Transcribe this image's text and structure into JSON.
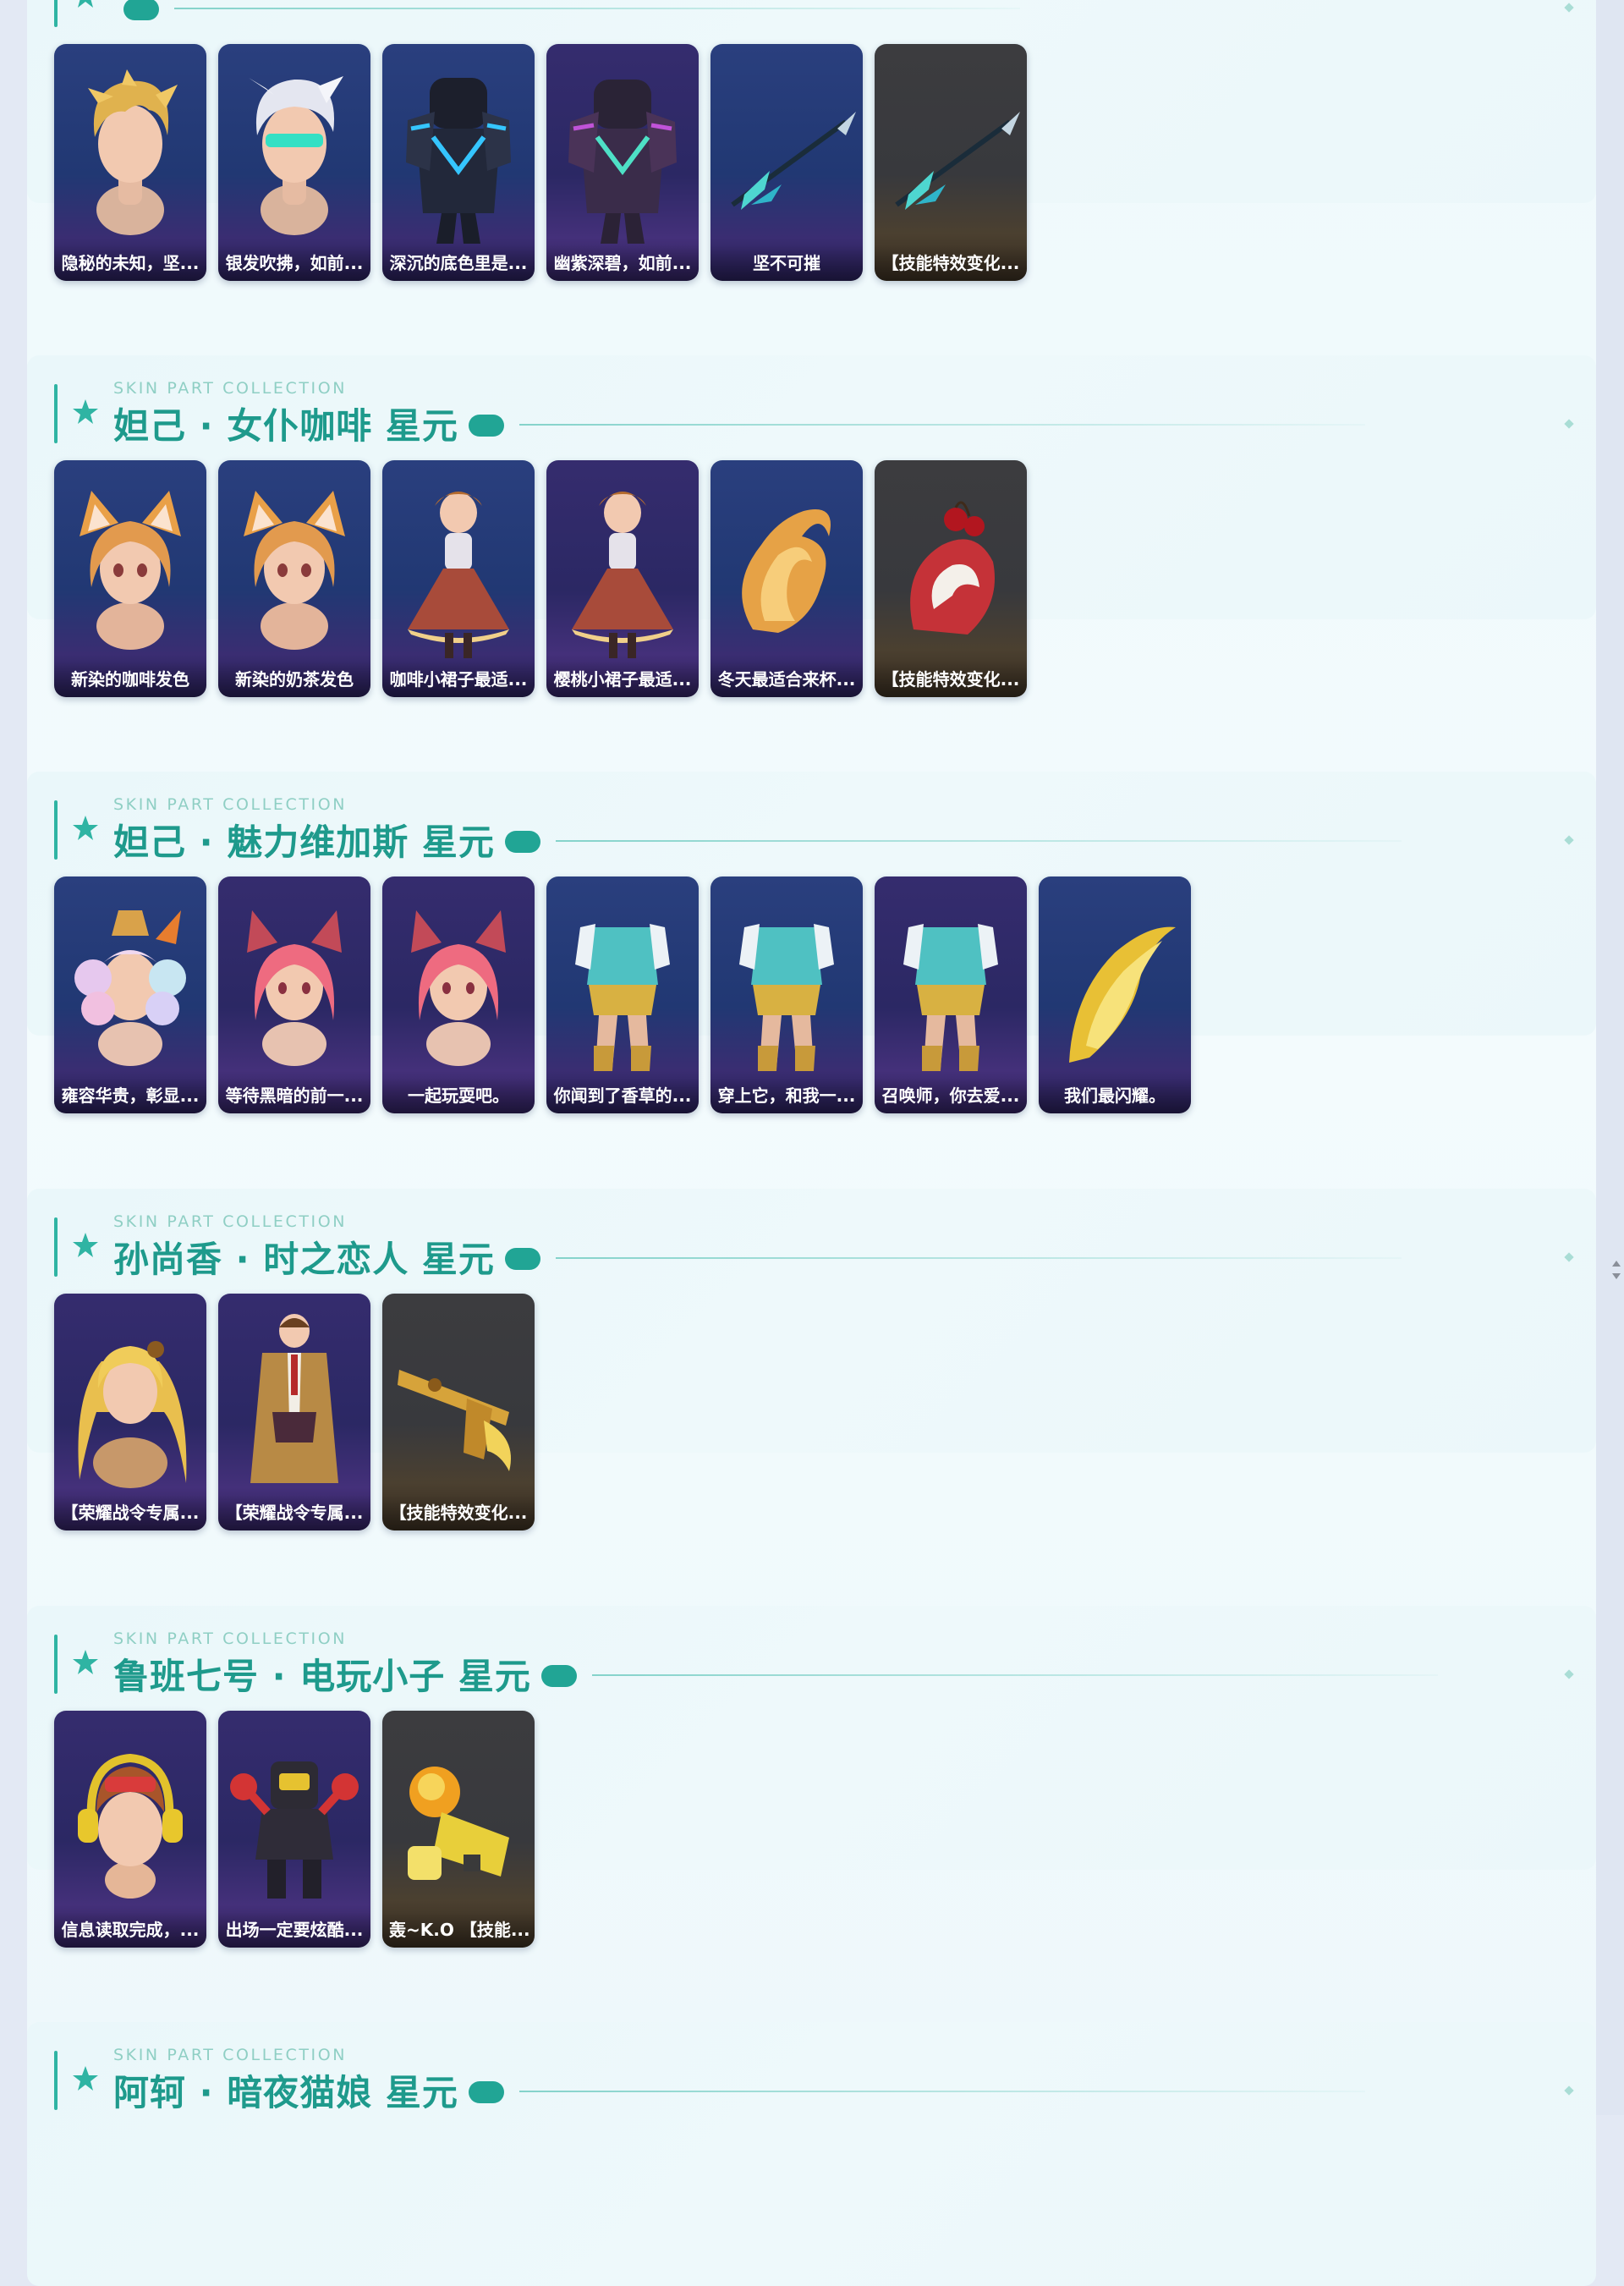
{
  "kicker": "SKIN PART COLLECTION",
  "accent_color": "#2fb4a3",
  "title_color": "#1e9a8c",
  "sections": [
    {
      "title": "",
      "cards": [
        {
          "label": "隐秘的未知，坚...",
          "icon": "blonde-hair-icon",
          "tone": "blue"
        },
        {
          "label": "银发吹拂，如前...",
          "icon": "silver-hair-visor-icon",
          "tone": "blue"
        },
        {
          "label": "深沉的底色里是...",
          "icon": "dark-armor-icon",
          "tone": "blue"
        },
        {
          "label": "幽紫深碧，如前...",
          "icon": "purple-armor-icon",
          "tone": "purple"
        },
        {
          "label": "坚不可摧",
          "icon": "spear-icon",
          "tone": "blue"
        },
        {
          "label": "【技能特效变化...",
          "icon": "spear-icon",
          "tone": "dark"
        }
      ]
    },
    {
      "title": "妲己 · 女仆咖啡 星元",
      "cards": [
        {
          "label": "新染的咖啡发色",
          "icon": "fox-ear-hair-icon",
          "tone": "blue"
        },
        {
          "label": "新染的奶茶发色",
          "icon": "fox-ear-hair-icon",
          "tone": "blue"
        },
        {
          "label": "咖啡小裙子最适...",
          "icon": "dress-icon",
          "tone": "blue"
        },
        {
          "label": "樱桃小裙子最适...",
          "icon": "dress-icon",
          "tone": "purple"
        },
        {
          "label": "冬天最适合来杯...",
          "icon": "fox-tail-icon",
          "tone": "blue"
        },
        {
          "label": "【技能特效变化...",
          "icon": "cherry-effect-icon",
          "tone": "dark"
        }
      ]
    },
    {
      "title": "妲己 · 魅力维加斯 星元",
      "cards": [
        {
          "label": "雍容华贵，彰显...",
          "icon": "curly-hair-hat-icon",
          "tone": "blue"
        },
        {
          "label": "等待黑暗的前一...",
          "icon": "pink-hair-icon",
          "tone": "purple"
        },
        {
          "label": "一起玩耍吧。",
          "icon": "pink-hair-icon",
          "tone": "purple"
        },
        {
          "label": "你闻到了香草的...",
          "icon": "outfit-icon",
          "tone": "blue"
        },
        {
          "label": "穿上它，和我一...",
          "icon": "outfit-icon",
          "tone": "blue"
        },
        {
          "label": "召唤师，你去爱...",
          "icon": "outfit-icon",
          "tone": "purple"
        },
        {
          "label": "我们最闪耀。",
          "icon": "golden-tail-icon",
          "tone": "blue"
        }
      ]
    },
    {
      "title": "孙尚香 · 时之恋人 星元",
      "cards": [
        {
          "label": "【荣耀战令专属...",
          "icon": "blonde-long-hair-icon",
          "tone": "purple"
        },
        {
          "label": "【荣耀战令专属...",
          "icon": "trench-coat-icon",
          "tone": "purple"
        },
        {
          "label": "【技能特效变化...",
          "icon": "golden-gun-icon",
          "tone": "dark"
        }
      ]
    },
    {
      "title": "鲁班七号 · 电玩小子 星元",
      "cards": [
        {
          "label": "信息读取完成，...",
          "icon": "headphones-head-icon",
          "tone": "purple"
        },
        {
          "label": "出场一定要炫酷...",
          "icon": "robot-body-icon",
          "tone": "purple"
        },
        {
          "label": "轰~K.O 【技能...",
          "icon": "toy-gun-icon",
          "tone": "dark"
        }
      ]
    },
    {
      "title": "阿轲 · 暗夜猫娘 星元",
      "cards": []
    }
  ]
}
